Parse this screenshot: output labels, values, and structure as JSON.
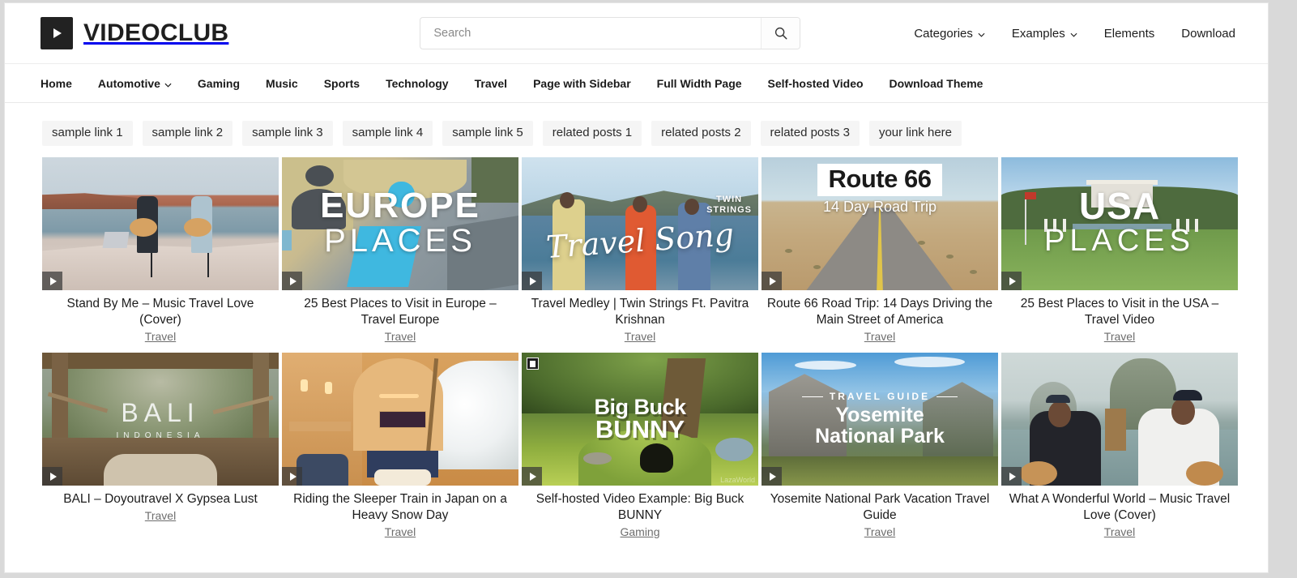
{
  "header": {
    "brand_name": "VIDEOCLUB",
    "brand_icon": "play-logo-icon",
    "search": {
      "placeholder": "Search",
      "value": "",
      "button_icon": "search-icon"
    },
    "top_nav": [
      {
        "label": "Categories",
        "has_caret": true
      },
      {
        "label": "Examples",
        "has_caret": true
      },
      {
        "label": "Elements",
        "has_caret": false
      },
      {
        "label": "Download",
        "has_caret": false
      }
    ]
  },
  "main_nav": [
    {
      "label": "Home",
      "has_caret": false
    },
    {
      "label": "Automotive",
      "has_caret": true
    },
    {
      "label": "Gaming",
      "has_caret": false
    },
    {
      "label": "Music",
      "has_caret": false
    },
    {
      "label": "Sports",
      "has_caret": false
    },
    {
      "label": "Technology",
      "has_caret": false
    },
    {
      "label": "Travel",
      "has_caret": false
    },
    {
      "label": "Page with Sidebar",
      "has_caret": false
    },
    {
      "label": "Full Width Page",
      "has_caret": false
    },
    {
      "label": "Self-hosted Video",
      "has_caret": false
    },
    {
      "label": "Download Theme",
      "has_caret": false
    }
  ],
  "tag_links": [
    "sample link 1",
    "sample link 2",
    "sample link 3",
    "sample link 4",
    "sample link 5",
    "related posts 1",
    "related posts 2",
    "related posts 3",
    "your link here"
  ],
  "videos": [
    {
      "title": "Stand By Me – Music Travel Love (Cover)",
      "category": "Travel",
      "play_icon": "play-icon",
      "overlay": {}
    },
    {
      "title": "25 Best Places to Visit in Europe – Travel Europe",
      "category": "Travel",
      "play_icon": "play-icon",
      "overlay": {
        "line1": "EUROPE",
        "line2": "PLACES"
      }
    },
    {
      "title": "Travel Medley | Twin Strings Ft. Pavitra Krishnan",
      "category": "Travel",
      "play_icon": "play-icon",
      "overlay": {
        "script": "Travel Song",
        "logo1": "TWIN",
        "logo2": "STRINGS"
      }
    },
    {
      "title": "Route 66 Road Trip: 14 Days Driving the Main Street of America",
      "category": "Travel",
      "play_icon": "play-icon",
      "overlay": {
        "line1": "Route 66",
        "line2": "14 Day Road Trip"
      }
    },
    {
      "title": "25 Best Places to Visit in the USA – Travel Video",
      "category": "Travel",
      "play_icon": "play-icon",
      "overlay": {
        "line1": "USA",
        "line2": "PLACES"
      }
    },
    {
      "title": "BALI – Doyoutravel X Gypsea Lust",
      "category": "Travel",
      "play_icon": "play-icon",
      "overlay": {
        "line1": "BALI",
        "line2": "INDONESIA"
      }
    },
    {
      "title": "Riding the Sleeper Train in Japan on a Heavy Snow Day",
      "category": "Travel",
      "play_icon": "play-icon",
      "overlay": {}
    },
    {
      "title": "Self-hosted Video Example: Big Buck BUNNY",
      "category": "Gaming",
      "play_icon": "play-icon",
      "badge_icon": "video-file-icon",
      "overlay": {
        "line1": "Big Buck",
        "line2": "BUNNY",
        "watermark": "LazaWorld"
      }
    },
    {
      "title": "Yosemite National Park Vacation Travel Guide",
      "category": "Travel",
      "play_icon": "play-icon",
      "overlay": {
        "kicker": "TRAVEL GUIDE",
        "line1": "Yosemite",
        "line2": "National Park"
      }
    },
    {
      "title": "What A Wonderful World – Music Travel Love (Cover)",
      "category": "Travel",
      "play_icon": "play-icon",
      "overlay": {}
    }
  ],
  "colors": {
    "page_bg": "#ffffff",
    "text": "#1c1c1c",
    "muted": "#6d6d6d",
    "tag_bg": "#f5f5f5",
    "brand": "#222222"
  }
}
